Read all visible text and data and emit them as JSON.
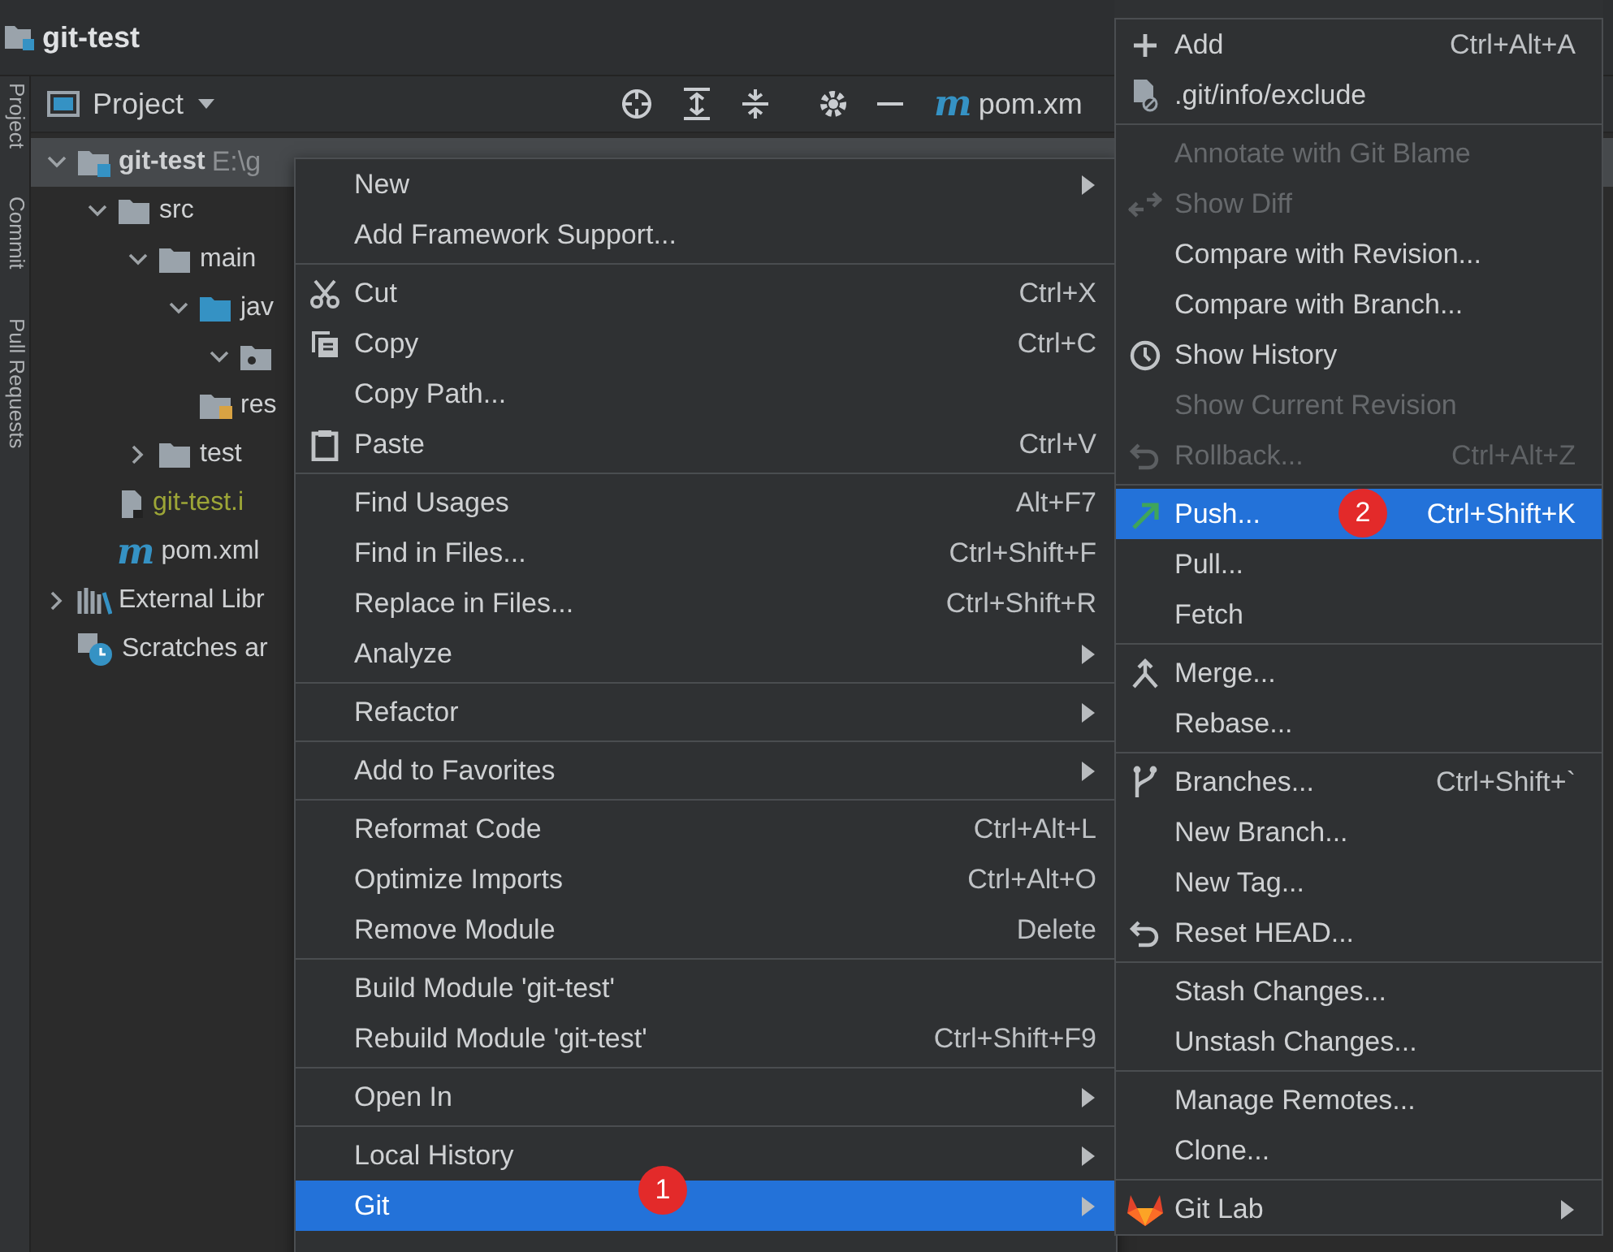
{
  "window": {
    "title": "git-test"
  },
  "side_strip": [
    {
      "label": "Project"
    },
    {
      "label": "Commit"
    },
    {
      "label": "Pull Requests"
    }
  ],
  "project_panel": {
    "title": "Project",
    "tab": {
      "icon": "m",
      "label": "pom.xm"
    },
    "tree": [
      {
        "label": "git-test",
        "path": "E:\\g",
        "kind": "module",
        "expanded": true,
        "selected": true,
        "children": [
          {
            "label": "src",
            "kind": "folder",
            "expanded": true,
            "selected": false,
            "children": [
              {
                "label": "main",
                "kind": "folder",
                "expanded": true,
                "selected": false,
                "children": [
                  {
                    "label": "jav",
                    "kind": "source",
                    "expanded": true,
                    "selected": false,
                    "children": [
                      {
                        "kind": "package",
                        "expanded": true,
                        "selected": false
                      }
                    ]
                  },
                  {
                    "label": "res",
                    "kind": "resources",
                    "selected": false
                  }
                ]
              },
              {
                "label": "test",
                "kind": "folder",
                "expanded": false,
                "selected": false
              }
            ]
          },
          {
            "label": "git-test.i",
            "kind": "iml",
            "selected": false
          },
          {
            "label": "pom.xml",
            "kind": "maven",
            "icon": "m",
            "selected": false
          }
        ]
      },
      {
        "label": "External Libr",
        "kind": "libraries",
        "expanded": false,
        "selected": false
      },
      {
        "label": "Scratches ar",
        "kind": "scratches",
        "selected": false
      }
    ]
  },
  "context_menu": {
    "groups": [
      [
        {
          "label": "New",
          "submenu": true,
          "selected": false
        },
        {
          "label": "Add Framework Support...",
          "selected": false
        }
      ],
      [
        {
          "label": "Cut",
          "shortcut": "Ctrl+X",
          "kind": "cut",
          "selected": false
        },
        {
          "label": "Copy",
          "shortcut": "Ctrl+C",
          "kind": "copy",
          "selected": false
        },
        {
          "label": "Copy Path...",
          "selected": false
        },
        {
          "label": "Paste",
          "shortcut": "Ctrl+V",
          "kind": "paste",
          "selected": false
        }
      ],
      [
        {
          "label": "Find Usages",
          "shortcut": "Alt+F7",
          "selected": false
        },
        {
          "label": "Find in Files...",
          "shortcut": "Ctrl+Shift+F",
          "selected": false
        },
        {
          "label": "Replace in Files...",
          "shortcut": "Ctrl+Shift+R",
          "selected": false
        },
        {
          "label": "Analyze",
          "submenu": true,
          "selected": false
        }
      ],
      [
        {
          "label": "Refactor",
          "submenu": true,
          "selected": false
        }
      ],
      [
        {
          "label": "Add to Favorites",
          "submenu": true,
          "selected": false
        }
      ],
      [
        {
          "label": "Reformat Code",
          "shortcut": "Ctrl+Alt+L",
          "selected": false
        },
        {
          "label": "Optimize Imports",
          "shortcut": "Ctrl+Alt+O",
          "selected": false
        },
        {
          "label": "Remove Module",
          "shortcut": "Delete",
          "selected": false
        }
      ],
      [
        {
          "label": "Build Module 'git-test'",
          "selected": false
        },
        {
          "label": "Rebuild Module 'git-test'",
          "shortcut": "Ctrl+Shift+F9",
          "selected": false
        }
      ],
      [
        {
          "label": "Open In",
          "submenu": true,
          "selected": false
        }
      ],
      [
        {
          "label": "Local History",
          "submenu": true,
          "selected": false
        },
        {
          "label": "Git",
          "submenu": true,
          "badge": "1",
          "selected": true
        }
      ]
    ]
  },
  "git_submenu": {
    "groups": [
      [
        {
          "label": "Add",
          "shortcut": "Ctrl+Alt+A",
          "kind": "add",
          "disabled": false,
          "selected": false
        },
        {
          "label": ".git/info/exclude",
          "kind": "exclude",
          "disabled": false,
          "selected": false
        }
      ],
      [
        {
          "label": "Annotate with Git Blame",
          "disabled": true,
          "selected": false
        },
        {
          "label": "Show Diff",
          "kind": "diff",
          "disabled": true,
          "selected": false
        },
        {
          "label": "Compare with Revision...",
          "disabled": false,
          "selected": false
        },
        {
          "label": "Compare with Branch...",
          "disabled": false,
          "selected": false
        },
        {
          "label": "Show History",
          "kind": "history",
          "disabled": false,
          "selected": false
        },
        {
          "label": "Show Current Revision",
          "disabled": true,
          "selected": false
        },
        {
          "label": "Rollback...",
          "shortcut": "Ctrl+Alt+Z",
          "kind": "rollback",
          "disabled": true,
          "selected": false
        }
      ],
      [
        {
          "label": "Push...",
          "shortcut": "Ctrl+Shift+K",
          "kind": "push",
          "badge": "2",
          "disabled": false,
          "selected": true
        },
        {
          "label": "Pull...",
          "disabled": false,
          "selected": false
        },
        {
          "label": "Fetch",
          "disabled": false,
          "selected": false
        }
      ],
      [
        {
          "label": "Merge...",
          "kind": "merge",
          "disabled": false,
          "selected": false
        },
        {
          "label": "Rebase...",
          "disabled": false,
          "selected": false
        }
      ],
      [
        {
          "label": "Branches...",
          "shortcut": "Ctrl+Shift+`",
          "kind": "branches",
          "disabled": false,
          "selected": false
        },
        {
          "label": "New Branch...",
          "disabled": false,
          "selected": false
        },
        {
          "label": "New Tag...",
          "disabled": false,
          "selected": false
        },
        {
          "label": "Reset HEAD...",
          "kind": "reset",
          "disabled": false,
          "selected": false
        }
      ],
      [
        {
          "label": "Stash Changes...",
          "disabled": false,
          "selected": false
        },
        {
          "label": "Unstash Changes...",
          "disabled": false,
          "selected": false
        }
      ],
      [
        {
          "label": "Manage Remotes...",
          "disabled": false,
          "selected": false
        },
        {
          "label": "Clone...",
          "disabled": false,
          "selected": false
        }
      ],
      [
        {
          "label": "Git Lab",
          "kind": "gitlab",
          "submenu": true,
          "disabled": false,
          "selected": false
        }
      ]
    ]
  }
}
